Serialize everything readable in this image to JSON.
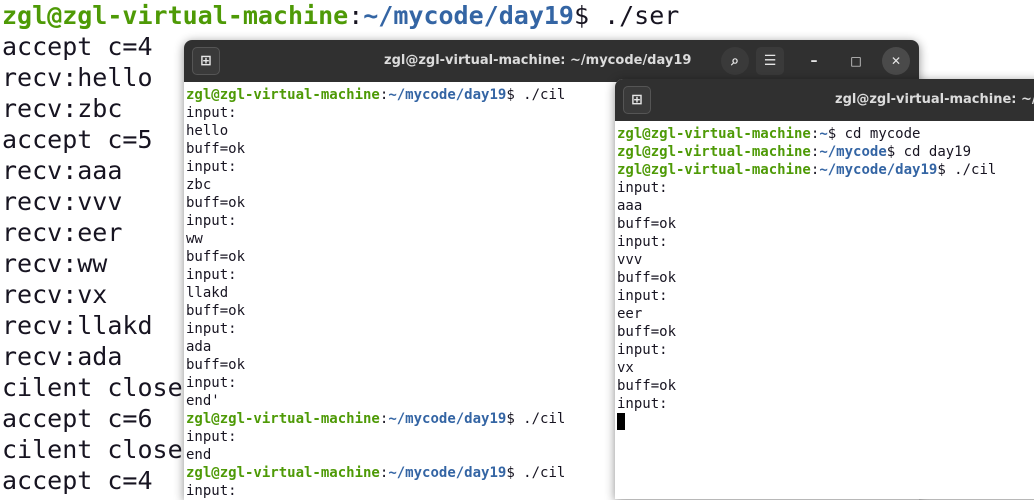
{
  "bg_terminal": {
    "prompt": {
      "user": "zgl@zgl-virtual-machine",
      "sep": ":",
      "path": "~/mycode/day19",
      "tail": "$ ./ser"
    },
    "lines": [
      "accept c=4",
      "recv:hello",
      "recv:zbc",
      "accept c=5",
      "recv:aaa",
      "recv:vvv",
      "recv:eer",
      "recv:ww",
      "recv:vx",
      "recv:llakd",
      "recv:ada",
      "cilent close",
      "accept c=6",
      "cilent close",
      "accept c=4"
    ]
  },
  "mid_window": {
    "title": "zgl@zgl-virtual-machine: ~/mycode/day19",
    "lines": [
      {
        "type": "prompt",
        "user": "zgl@zgl-virtual-machine",
        "sep": ":",
        "path": "~/mycode/day19",
        "tail": "$ ./cil"
      },
      {
        "type": "text",
        "text": "input:"
      },
      {
        "type": "text",
        "text": "hello"
      },
      {
        "type": "text",
        "text": "buff=ok"
      },
      {
        "type": "text",
        "text": "input:"
      },
      {
        "type": "text",
        "text": "zbc"
      },
      {
        "type": "text",
        "text": "buff=ok"
      },
      {
        "type": "text",
        "text": "input:"
      },
      {
        "type": "text",
        "text": "ww"
      },
      {
        "type": "text",
        "text": "buff=ok"
      },
      {
        "type": "text",
        "text": "input:"
      },
      {
        "type": "text",
        "text": "llakd"
      },
      {
        "type": "text",
        "text": "buff=ok"
      },
      {
        "type": "text",
        "text": "input:"
      },
      {
        "type": "text",
        "text": "ada"
      },
      {
        "type": "text",
        "text": "buff=ok"
      },
      {
        "type": "text",
        "text": "input:"
      },
      {
        "type": "text",
        "text": "end'"
      },
      {
        "type": "prompt",
        "user": "zgl@zgl-virtual-machine",
        "sep": ":",
        "path": "~/mycode/day19",
        "tail": "$ ./cil"
      },
      {
        "type": "text",
        "text": "input:"
      },
      {
        "type": "text",
        "text": "end"
      },
      {
        "type": "prompt",
        "user": "zgl@zgl-virtual-machine",
        "sep": ":",
        "path": "~/mycode/day19",
        "tail": "$ ./cil"
      },
      {
        "type": "text",
        "text": "input:"
      }
    ],
    "buttons": {
      "new_tab": "⊞",
      "search": "⌕",
      "menu": "☰",
      "minimize": "–",
      "maximize": "□",
      "close": "✕"
    }
  },
  "front_window": {
    "title": "zgl@zgl-virtual-machine: ~/m",
    "lines": [
      {
        "type": "prompt",
        "user": "zgl@zgl-virtual-machine",
        "sep": ":",
        "path": "~",
        "tail": "$ cd mycode"
      },
      {
        "type": "prompt",
        "user": "zgl@zgl-virtual-machine",
        "sep": ":",
        "path": "~/mycode",
        "tail": "$ cd day19"
      },
      {
        "type": "prompt",
        "user": "zgl@zgl-virtual-machine",
        "sep": ":",
        "path": "~/mycode/day19",
        "tail": "$ ./cil"
      },
      {
        "type": "text",
        "text": "input:"
      },
      {
        "type": "text",
        "text": "aaa"
      },
      {
        "type": "text",
        "text": "buff=ok"
      },
      {
        "type": "text",
        "text": "input:"
      },
      {
        "type": "text",
        "text": "vvv"
      },
      {
        "type": "text",
        "text": "buff=ok"
      },
      {
        "type": "text",
        "text": "input:"
      },
      {
        "type": "text",
        "text": "eer"
      },
      {
        "type": "text",
        "text": "buff=ok"
      },
      {
        "type": "text",
        "text": "input:"
      },
      {
        "type": "text",
        "text": "vx"
      },
      {
        "type": "text",
        "text": "buff=ok"
      },
      {
        "type": "text",
        "text": "input:"
      }
    ],
    "buttons": {
      "new_tab": "⊞"
    }
  },
  "colors": {
    "prompt_user": "#4e9a06",
    "prompt_path": "#3465a4",
    "titlebar": "#303030"
  }
}
